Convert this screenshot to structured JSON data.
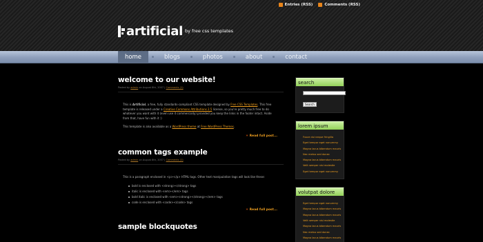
{
  "header": {
    "rss_links": [
      {
        "label": "Entries (RSS)"
      },
      {
        "label": "Comments (RSS)"
      }
    ],
    "logo_name": "artificial",
    "logo_tagline": "by free css templates"
  },
  "nav": {
    "items": [
      "home",
      "blogs",
      "photos",
      "about",
      "contact"
    ],
    "active": "home"
  },
  "posts": [
    {
      "title": "welcome to our website!",
      "meta_posted": "Posted by",
      "meta_author": "admin",
      "meta_date": "on August 8th, 2007",
      "meta_comments": "Comments (1)",
      "body_pre": "This is ",
      "body_bold": "Artificial",
      "body_mid1": ", a free, fully standards-compliant CSS template designed by ",
      "body_link1": "Free CSS Templates",
      "body_mid2": ". This free template is released under a ",
      "body_link2": "Creative Commons Attributions 2.5",
      "body_mid3": " license, so you're pretty much free to do whatever you want with it (even use it commercially) provided you keep the links in the footer intact. Aside from that, have fun with it :)",
      "body2_pre": "This template is also available as a ",
      "body2_link1": "WordPress theme",
      "body2_mid": " at ",
      "body2_link2": "Free WordPress Themes",
      "body2_post": ".",
      "readmore": "Read full post..."
    },
    {
      "title": "common tags example",
      "meta_posted": "Posted by",
      "meta_author": "admin",
      "meta_date": "on August 8th, 2007",
      "meta_comments": "Comments (1)",
      "intro": "This is a paragraph enclosed in <p></p> HTML tags. Other text manipulation tags will look like these:",
      "tags": [
        "bold is enclosed with <strong></strong> tags",
        "italic is enclosed with <em></em> tags",
        "bold italic is enclosed with <em><strong></strong></em> tags",
        "code is enclosed with <code></code> tags"
      ],
      "readmore": "Read full post..."
    },
    {
      "title": "sample blockquotes"
    }
  ],
  "sidebar": {
    "search_title": "search",
    "search_button": "Search",
    "lorem_title": "lorem ipsum",
    "lorem_items": [
      "Fusce dui neque fringilla",
      "Eget tempor eget nonummy",
      "Magna lacus bibendum mauris",
      "Nec metus sed donec",
      "Magna lacus bibendum mauris",
      "Velit semper nisi molestie",
      "Eget tempor eget nonummy"
    ],
    "volutpat_title": "volutpat dolore",
    "volutpat_items": [
      "Eget tempor eget nonummy",
      "Magna lacus bibendum mauris",
      "Magna lacus bibendum mauris",
      "Velit semper nisi molestie",
      "Magna lacus bibendum mauris",
      "Nec metus sed donec",
      "Magna lacus bibendum mauris"
    ]
  },
  "colors": {
    "accent_orange": "#f0a020",
    "sidebar_title_green": "#94d25a",
    "nav_blue": "#8e9fbb",
    "nav_active": "#5d6d86"
  }
}
